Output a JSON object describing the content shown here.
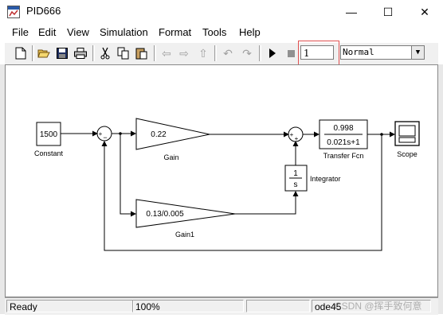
{
  "window": {
    "title": "PID666",
    "minimize": "—",
    "maximize": "☐",
    "close": "✕"
  },
  "menu": [
    "File",
    "Edit",
    "View",
    "Simulation",
    "Format",
    "Tools",
    "Help"
  ],
  "toolbar": {
    "stop_time": "1",
    "sim_mode": "Normal",
    "icons": [
      "new-icon",
      "open-icon",
      "save-icon",
      "print-icon",
      "cut-icon",
      "copy-icon",
      "paste-icon",
      "back-icon",
      "forward-icon",
      "up-icon",
      "undo-icon",
      "redo-icon",
      "run-icon",
      "stop-icon"
    ]
  },
  "blocks": {
    "constant": {
      "value": "1500",
      "label": "Constant"
    },
    "gain": {
      "value": "0.22",
      "label": "Gain"
    },
    "gain1": {
      "value": "0.13/0.005",
      "label": "Gain1"
    },
    "integrator": {
      "num": "1",
      "den": "s",
      "label": "Integrator"
    },
    "transfer": {
      "num": "0.998",
      "den": "0.021s+1",
      "label": "Transfer Fcn"
    },
    "scope": {
      "label": "Scope"
    },
    "sum1": {
      "signs": [
        "+",
        "−"
      ]
    },
    "sum2": {
      "signs": [
        "+",
        "+"
      ]
    }
  },
  "status": {
    "state": "Ready",
    "zoom": "100%",
    "solver": "ode45"
  },
  "watermark": "CSDN @挥手致何意"
}
